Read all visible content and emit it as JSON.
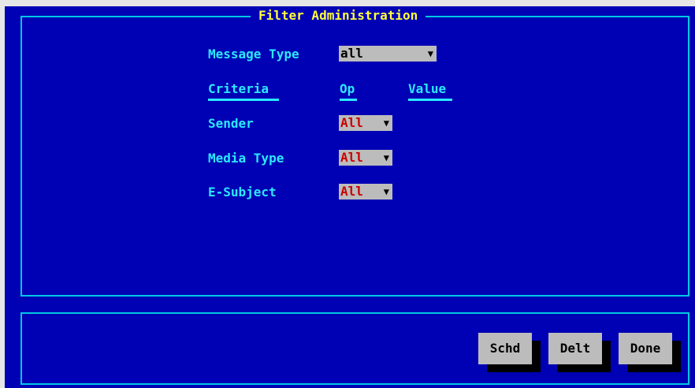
{
  "window": {
    "title": "Filter Administration"
  },
  "message_type": {
    "label": "Message Type",
    "value": "all",
    "arrow_icon": "down-triangle-icon"
  },
  "criteria_headers": {
    "criteria": "Criteria",
    "op": "Op",
    "value": "Value"
  },
  "criteria_rows": [
    {
      "label": "Sender",
      "op": "All"
    },
    {
      "label": "Media Type",
      "op": "All"
    },
    {
      "label": "E-Subject",
      "op": "All"
    }
  ],
  "buttons": {
    "schd": "Schd",
    "delt": "Delt",
    "done": "Done"
  },
  "colors": {
    "background": "#0000b4",
    "border": "#00c8e6",
    "title": "#ffff3c",
    "label": "#2ce8ff",
    "field": "#bcbcbc",
    "op_value": "#c80000"
  }
}
